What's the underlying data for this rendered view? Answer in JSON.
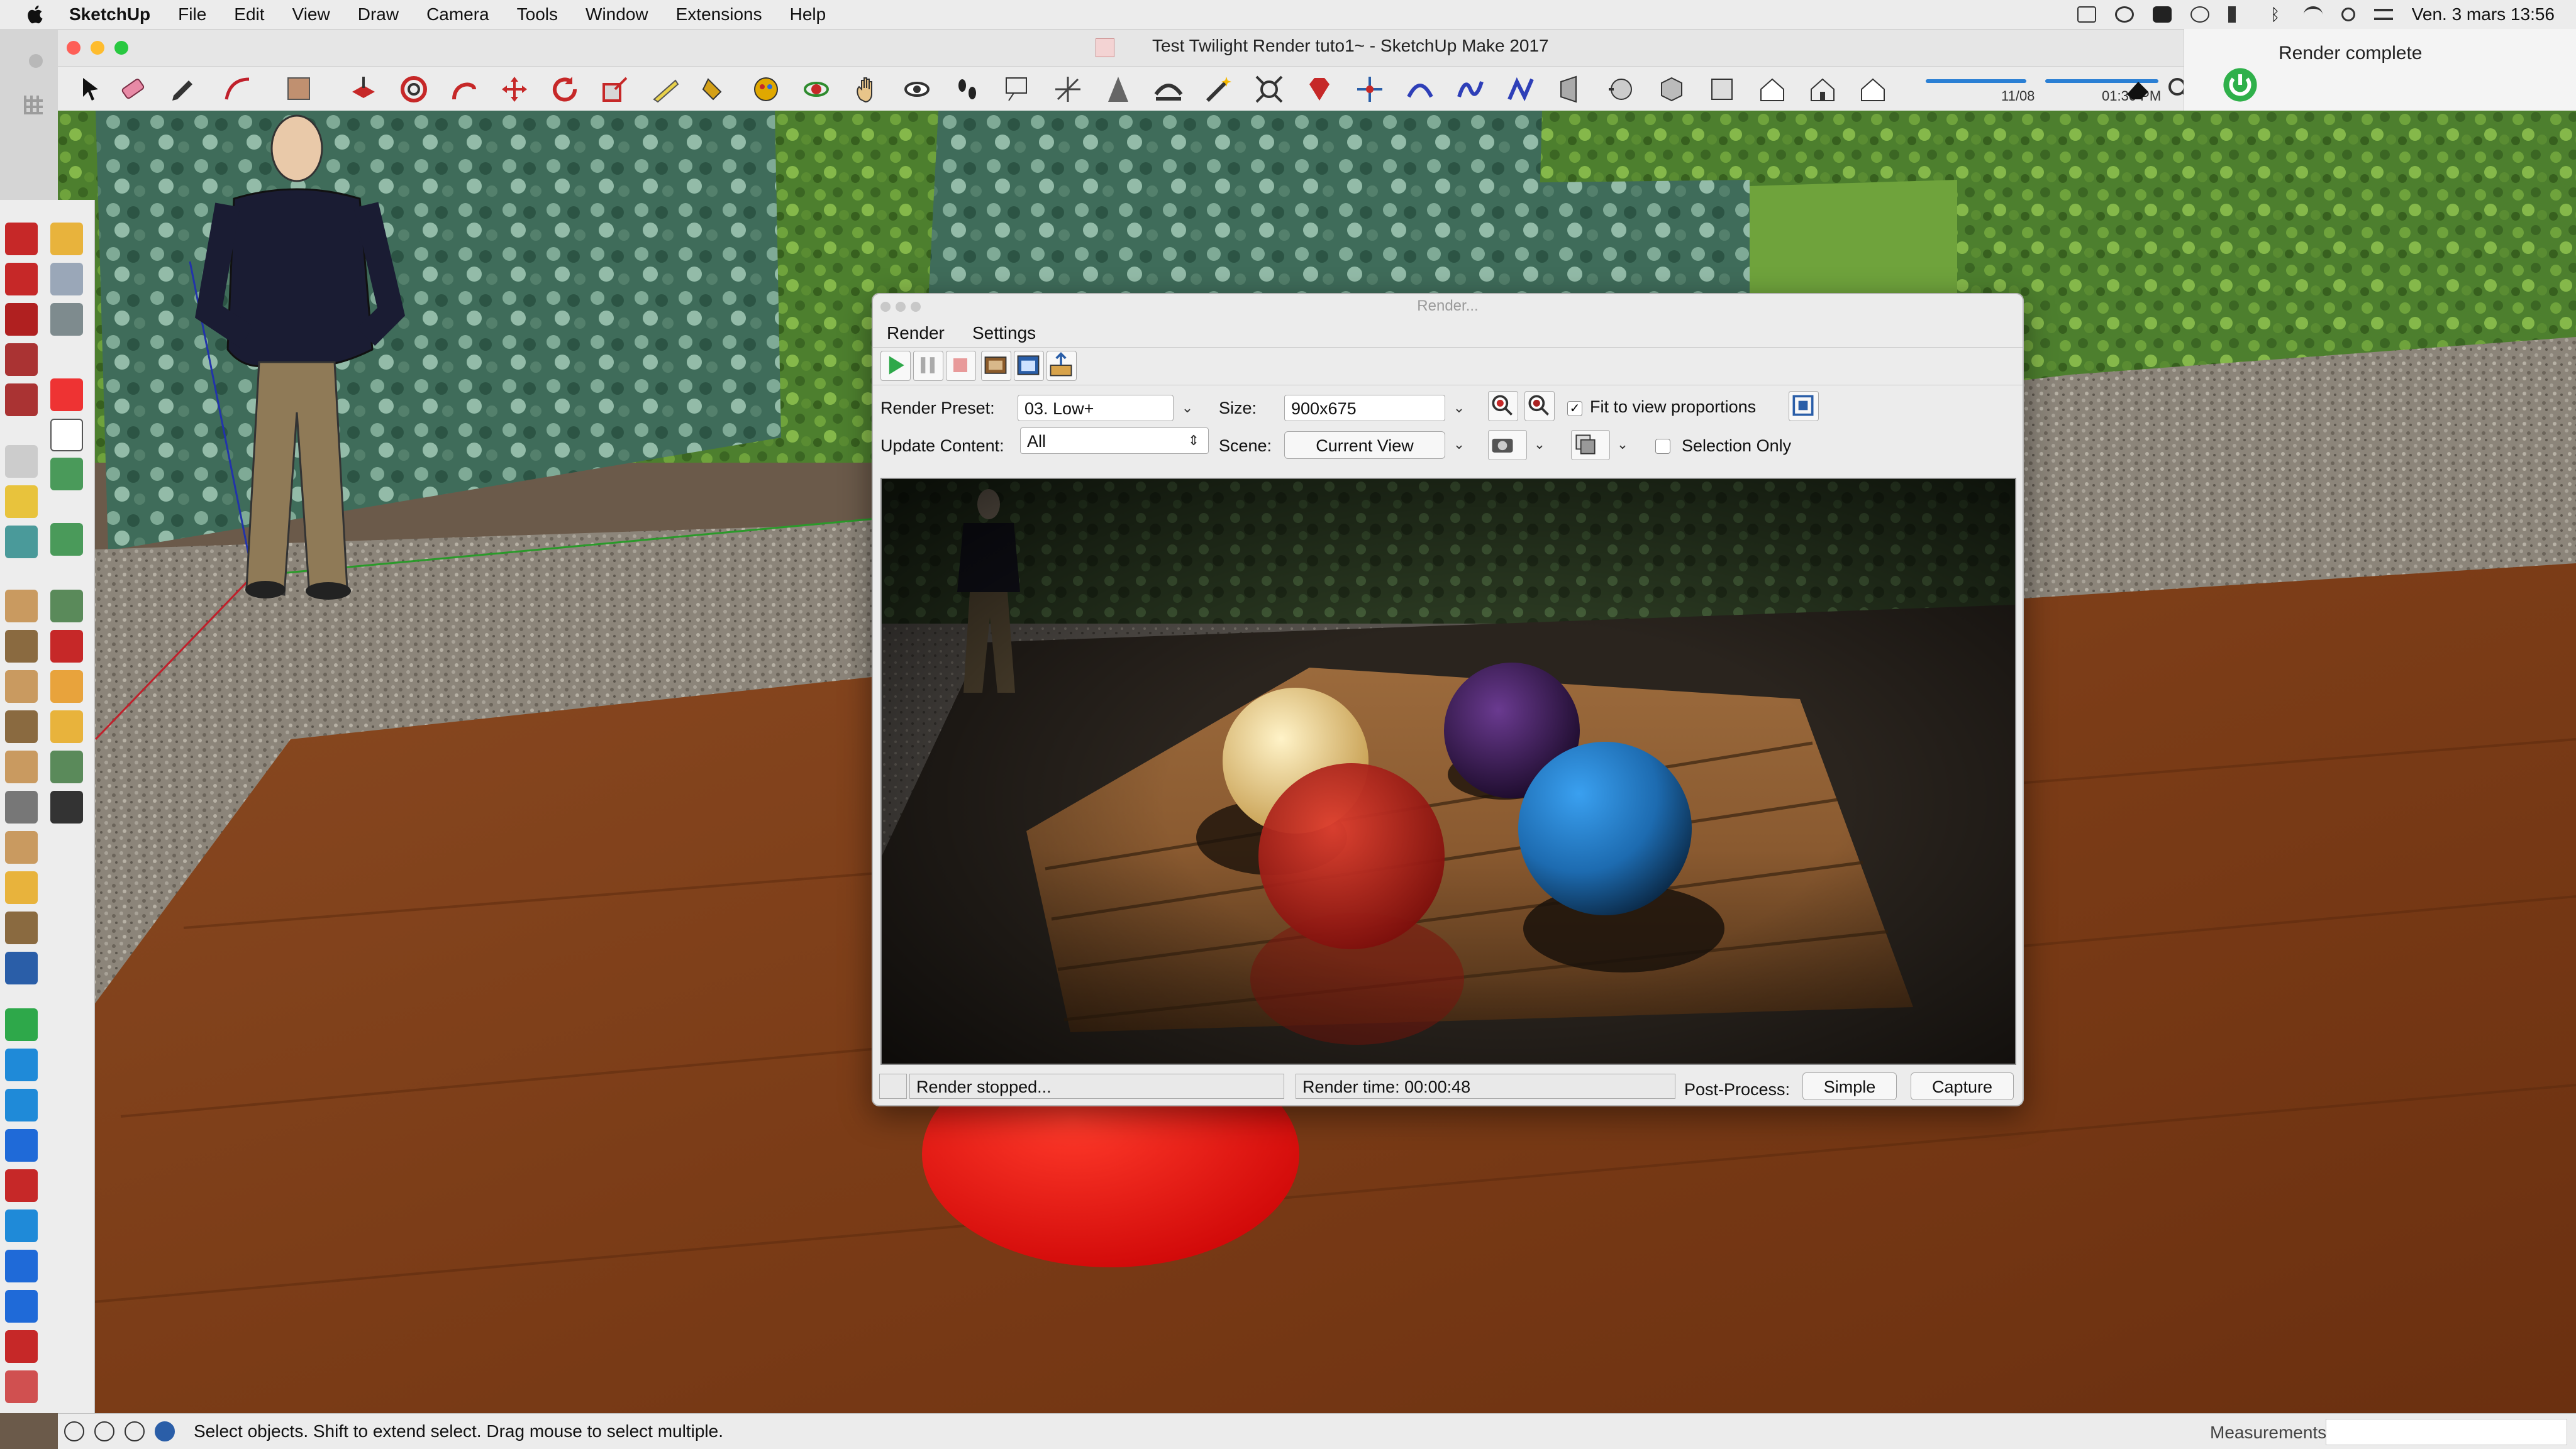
{
  "menubar": {
    "app_name": "SketchUp",
    "items": [
      "File",
      "Edit",
      "View",
      "Draw",
      "Camera",
      "Tools",
      "Window",
      "Extensions",
      "Help"
    ],
    "clock": "Ven. 3 mars  13:56"
  },
  "window": {
    "title": "Test Twilight Render tuto1~ - SketchUp Make 2017"
  },
  "toolbar": {
    "shadow_date": "11/08",
    "shadow_time": "01:30 PM"
  },
  "notification": {
    "text": "Render complete"
  },
  "render_dialog": {
    "title": "Render...",
    "tabs": [
      "Render",
      "Settings"
    ],
    "preset_label": "Render Preset:",
    "preset_value": "03. Low+",
    "size_label": "Size:",
    "size_value": "900x675",
    "fit_label": "Fit to view proportions",
    "fit_checked": true,
    "update_label": "Update Content:",
    "update_value": "All",
    "scene_label": "Scene:",
    "scene_value": "Current View",
    "selection_only_label": "Selection Only",
    "selection_only_checked": false,
    "status_text": "Render stopped...",
    "render_time": "Render time: 00:00:48",
    "postprocess_label": "Post-Process:",
    "simple_button": "Simple",
    "capture_button": "Capture"
  },
  "statusbar": {
    "message": "Select objects. Shift to extend select. Drag mouse to select multiple.",
    "measurements_label": "Measurements"
  },
  "colors": {
    "floor_wood": "#7a3a18",
    "hedge_green": "#4f7f2c",
    "gravel": "#8b8478",
    "red_sphere": "#e01010",
    "blue_sphere": "#1f7fd0",
    "purple_sphere": "#3a1550",
    "yellow_sphere": "#f0d080"
  }
}
